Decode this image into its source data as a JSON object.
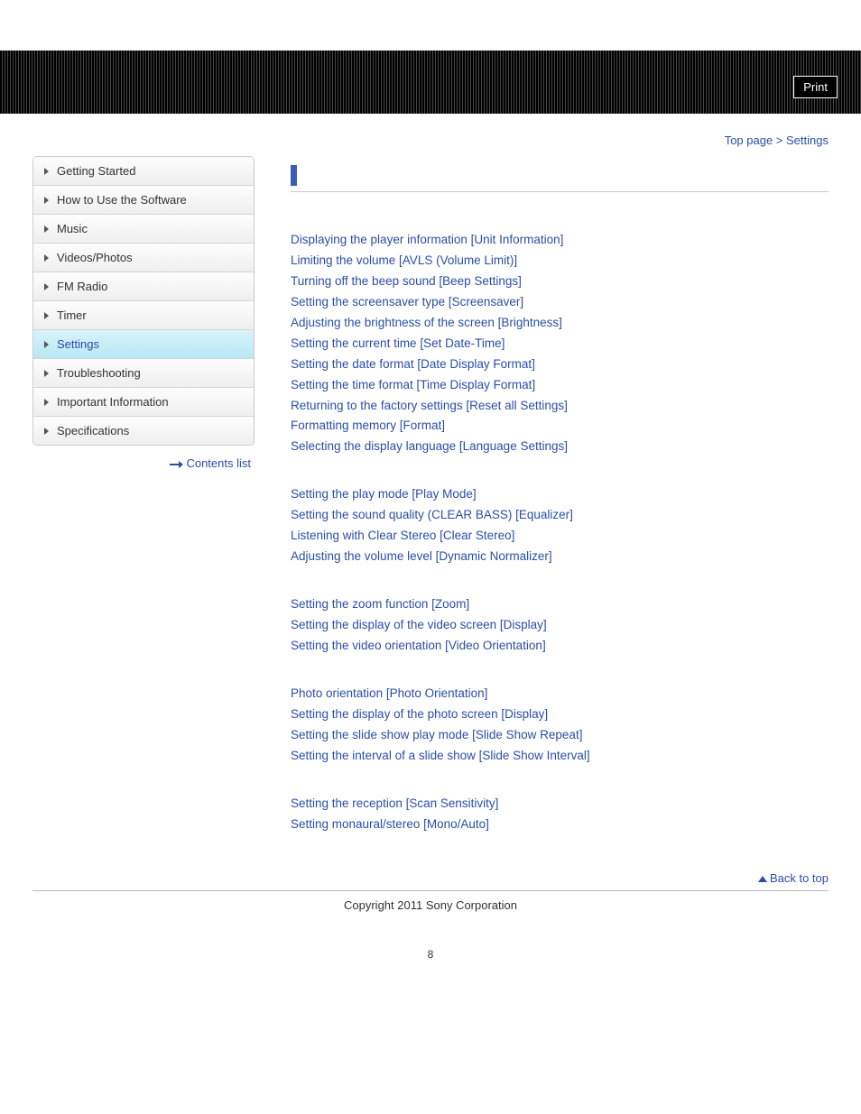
{
  "print_label": "Print",
  "breadcrumb": {
    "top_page": "Top page",
    "sep": " > ",
    "current": "Settings"
  },
  "sidebar": {
    "items": [
      {
        "label": "Getting Started",
        "active": false
      },
      {
        "label": "How to Use the Software",
        "active": false
      },
      {
        "label": "Music",
        "active": false
      },
      {
        "label": "Videos/Photos",
        "active": false
      },
      {
        "label": "FM Radio",
        "active": false
      },
      {
        "label": "Timer",
        "active": false
      },
      {
        "label": "Settings",
        "active": true
      },
      {
        "label": "Troubleshooting",
        "active": false
      },
      {
        "label": "Important Information",
        "active": false
      },
      {
        "label": "Specifications",
        "active": false
      }
    ],
    "contents_list": "Contents list"
  },
  "groups": [
    {
      "links": [
        "Displaying the player information [Unit Information]",
        "Limiting the volume [AVLS (Volume Limit)]",
        "Turning off the beep sound [Beep Settings]",
        "Setting the screensaver type [Screensaver]",
        "Adjusting the brightness of the screen [Brightness]",
        "Setting the current time [Set Date-Time]",
        "Setting the date format [Date Display Format]",
        "Setting the time format [Time Display Format]",
        "Returning to the factory settings [Reset all Settings]",
        "Formatting memory [Format]",
        "Selecting the display language [Language Settings]"
      ]
    },
    {
      "links": [
        "Setting the play mode [Play Mode]",
        "Setting the sound quality (CLEAR BASS) [Equalizer]",
        "Listening with Clear Stereo [Clear Stereo]",
        "Adjusting the volume level [Dynamic Normalizer]"
      ]
    },
    {
      "links": [
        "Setting the zoom function [Zoom]",
        "Setting the display of the video screen [Display]",
        "Setting the video orientation [Video Orientation]"
      ]
    },
    {
      "links": [
        "Photo orientation [Photo Orientation]",
        "Setting the display of the photo screen [Display]",
        "Setting the slide show play mode [Slide Show Repeat]",
        "Setting the interval of a slide show [Slide Show Interval]"
      ]
    },
    {
      "links": [
        "Setting the reception [Scan Sensitivity]",
        "Setting monaural/stereo [Mono/Auto]"
      ]
    }
  ],
  "back_to_top": "Back to top",
  "copyright": "Copyright 2011 Sony Corporation",
  "page_number": "8"
}
